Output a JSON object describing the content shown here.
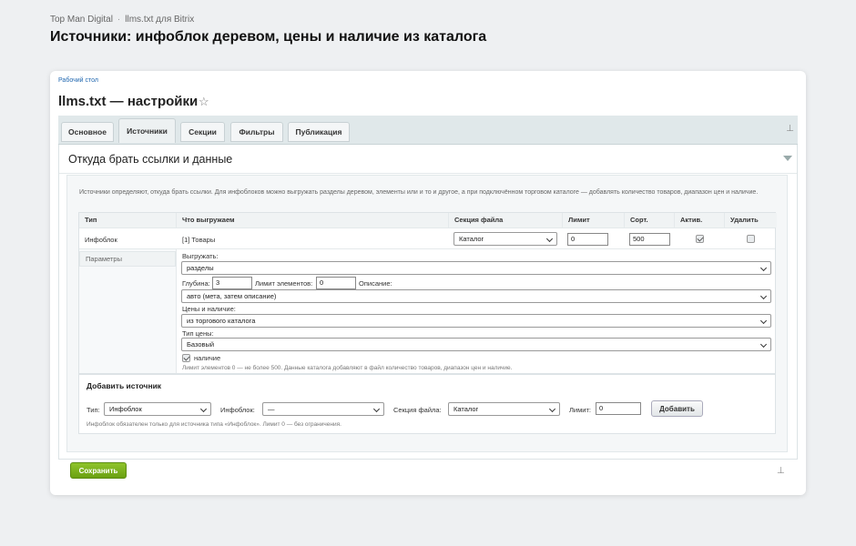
{
  "breadcrumb": {
    "company": "Top Man Digital",
    "separator": "·",
    "module": "llms.txt для Bitrix"
  },
  "page_title": "Источники: инфоблок деревом, цены и наличие из каталога",
  "card": {
    "desk_link": "Рабочий стол",
    "title": "llms.txt — настройки",
    "star_icon": "star-icon",
    "pin_icon": "pin-icon"
  },
  "tabs": [
    {
      "label": "Основное",
      "active": false
    },
    {
      "label": "Источники",
      "active": true
    },
    {
      "label": "Секции",
      "active": false
    },
    {
      "label": "Фильтры",
      "active": false
    },
    {
      "label": "Публикация",
      "active": false
    }
  ],
  "section": {
    "title": "Откуда брать ссылки и данные",
    "description": "Источники определяют, откуда брать ссылки. Для инфоблоков можно выгружать разделы деревом, элементы или и то и другое, а при подключённом торговом каталоге — добавлять количество товаров, диапазон цен и наличие."
  },
  "table": {
    "headers": {
      "type": "Тип",
      "what": "Что выгружаем",
      "file_section": "Секция файла",
      "limit": "Лимит",
      "sort": "Сорт.",
      "active": "Актив.",
      "delete": "Удалить"
    },
    "row": {
      "type": "Инфоблок",
      "what": "[1] Товары",
      "file_section": "Каталог",
      "limit": "0",
      "sort": "500",
      "active": true,
      "delete": false
    },
    "params_label": "Параметры",
    "params": {
      "export_label": "Выгружать:",
      "export_value": "разделы",
      "depth_label": "Глубина:",
      "depth_value": "3",
      "elements_limit_label": "Лимит элементов:",
      "elements_limit_value": "0",
      "description_label": "Описание:",
      "description_value": "авто (мета, затем описание)",
      "prices_label": "Цены и наличие:",
      "prices_value": "из торгового каталога",
      "price_type_label": "Тип цены:",
      "price_type_value": "Базовый",
      "availability_label": "наличие",
      "availability_checked": true,
      "note": "Лимит элементов 0 — не более 500. Данные каталога добавляют в файл количество товаров, диапазон цен и наличие."
    }
  },
  "add_source": {
    "title": "Добавить источник",
    "type_label": "Тип:",
    "type_value": "Инфоблок",
    "iblock_label": "Инфоблок:",
    "iblock_value": "—",
    "section_label": "Секция файла:",
    "section_value": "Каталог",
    "limit_label": "Лимит:",
    "limit_value": "0",
    "button": "Добавить",
    "note": "Инфоблок обязателен только для источника типа «Инфоблок». Лимит 0 — без ограничения."
  },
  "save_button": "Сохранить"
}
